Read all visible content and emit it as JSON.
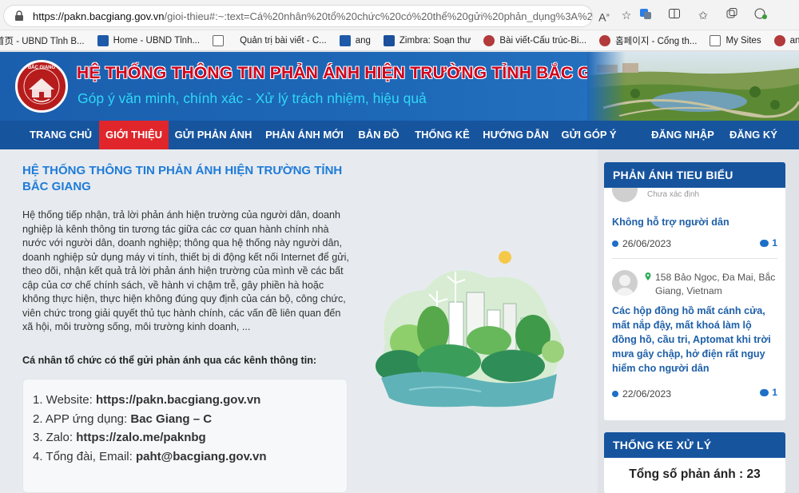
{
  "browser": {
    "url_host": "https://pakn.bacgiang.gov.vn",
    "url_path": "/gioi-thieu#:~:text=Cá%20nhân%20tổ%20chức%20có%20thể%20gửi%20phản_dụng%3A%2...",
    "icons": [
      "read-aloud-icon",
      "favorite-star-icon",
      "translate-icon",
      "split-screen-icon",
      "favorites-icon",
      "collections-icon",
      "extensions-icon"
    ]
  },
  "bookmarks": [
    {
      "label": "首页 - UBND Tỉnh B...",
      "color": "#c8c8c8"
    },
    {
      "label": "Home - UBND Tỉnh...",
      "color": "#1e5aa8"
    },
    {
      "label": "Quản trị bài viết - C...",
      "color": "#ffffff"
    },
    {
      "label": "ang",
      "color": "#1e5aa8"
    },
    {
      "label": "Zimbra: Soạn thư",
      "color": "#1c4f9c"
    },
    {
      "label": "Bài viết-Cấu trúc-Bi...",
      "color": "#b23a3a"
    },
    {
      "label": "홈페이지 - Cổng th...",
      "color": "#b23a3a"
    },
    {
      "label": "My Sites",
      "color": "#ffffff"
    },
    {
      "label": "ang",
      "color": "#b23a3a"
    }
  ],
  "header": {
    "logo_text": "BẮC GIANG",
    "title": "HỆ THỐNG THÔNG TIN PHẢN ÁNH HIỆN TRƯỜNG TỈNH BẮC GIANG",
    "slogan": "Góp ý văn minh, chính xác - Xử lý trách nhiệm, hiệu quả"
  },
  "nav": {
    "items": [
      "TRANG CHỦ",
      "GIỚI THIỆU",
      "GỬI PHẢN ÁNH",
      "PHẢN ÁNH MỚI",
      "BẢN ĐỒ",
      "THỐNG KÊ",
      "HƯỚNG DẪN",
      "GỬI GÓP Ý"
    ],
    "login": "ĐĂNG NHẬP",
    "register": "ĐĂNG KÝ",
    "active_index": 1,
    "active_color": "#e0262b"
  },
  "main": {
    "title": "HỆ THỐNG THÔNG TIN PHẢN ÁNH HIỆN TRƯỜNG TỈNH BẮC GIANG",
    "intro": "Hệ thống tiếp nhận, trả lời phản ánh hiện trường của người dân, doanh nghiệp là kênh thông tin tương tác giữa các cơ quan hành chính nhà nước với người dân, doanh nghiệp; thông qua hệ thống này người dân, doanh nghiệp sử dụng máy vi tính, thiết bị di động kết nối Internet để gửi, theo dõi, nhận kết quả trả lời phản ánh hiện trường của mình về các bất cập của cơ chế chính sách, về hành vi chậm trễ, gây phiền hà hoặc không thực hiện, thực hiện không đúng quy định của cán bộ, công chức, viên chức trong giải quyết thủ tục hành chính, các vấn đề liên quan đến xã hội, môi trường sống, môi trường kinh doanh, ...",
    "channels_label": "Cá nhân tổ chức có thể gửi phản ánh qua các kênh thông tin:",
    "channels": [
      {
        "prefix": "1. Website: ",
        "value": "https://pakn.bacgiang.gov.vn"
      },
      {
        "prefix": "2. APP ứng dụng: ",
        "value": "Bac Giang – C"
      },
      {
        "prefix": "3. Zalo: ",
        "value": "https://zalo.me/paknbg"
      },
      {
        "prefix": "4. Tổng đài, Email: ",
        "value": "paht@bacgiang.gov.vn"
      }
    ]
  },
  "sidebar": {
    "featured_title": "PHẢN ÁNH TIEU BIỂU",
    "stub_text": "Chưa xác định",
    "items": [
      {
        "title": "Không hỗ trợ người dân",
        "date": "26/06/2023",
        "comments": "1"
      },
      {
        "address": "158 Bảo Ngọc, Đa Mai, Bắc Giang, Vietnam",
        "title": "Các hộp đồng hồ mất cánh cửa, mất nắp đậy, mất khoá làm lộ đồng hồ, cầu tri, Aptomat khi trời mưa gây chập, hở điện rất nguy hiểm cho người dân",
        "date": "22/06/2023",
        "comments": "1"
      }
    ],
    "stats_title": "THỐNG KE XỬ LÝ",
    "stats_line": "Tổng số phản ánh : 23"
  }
}
